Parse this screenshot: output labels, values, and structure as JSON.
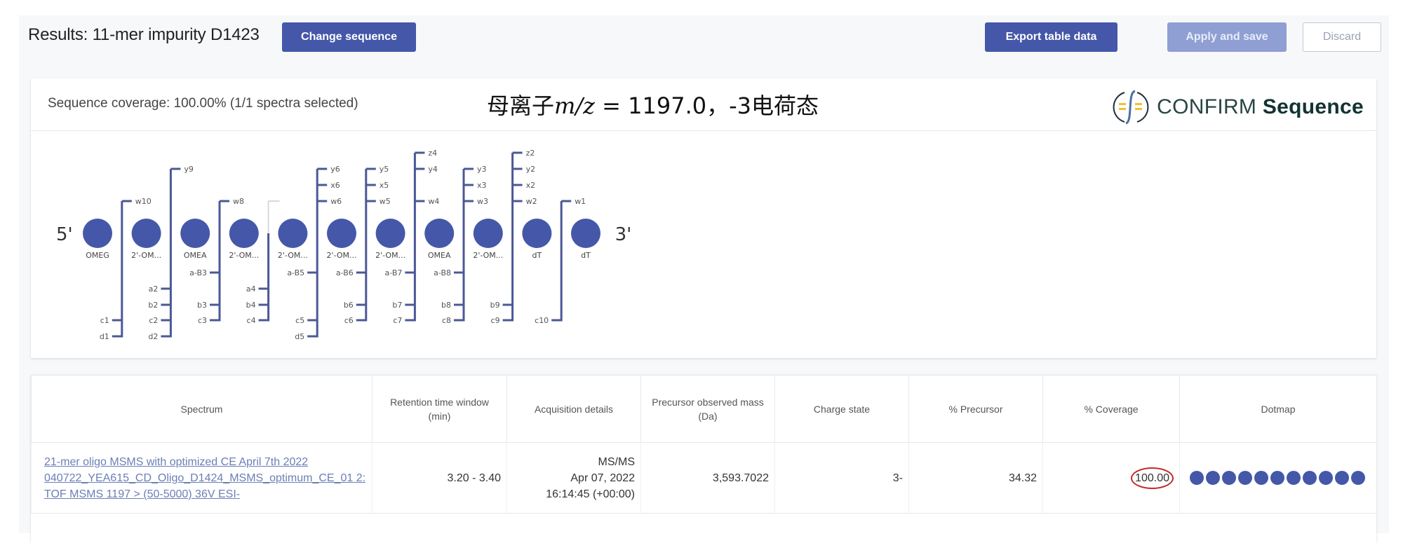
{
  "header": {
    "title": "Results: 11-mer impurity D1423",
    "change_sequence": "Change sequence",
    "export": "Export table data",
    "apply": "Apply and save",
    "discard": "Discard"
  },
  "card": {
    "coverage": "Sequence coverage: 100.00% (1/1 spectra selected)",
    "annotation_prefix": "母离子",
    "annotation_mz": "m/z",
    "annotation_suffix": " = 1197.0，-3电荷态",
    "logo_light": "CONFIRM",
    "logo_bold": "Sequence",
    "logo_icon": "confirm-sequence-logo-icon"
  },
  "sequence": {
    "five_prime": "5'",
    "three_prime": "3'",
    "colors": {
      "nucleotide": "#4557a8",
      "line": "#4b5896",
      "inactive_line": "#d7d9dc"
    },
    "nucleotides": [
      "OMEG",
      "2'-OM...",
      "OMEA",
      "2'-OM...",
      "2'-OM...",
      "2'-OM...",
      "2'-OM...",
      "OMEA",
      "2'-OM...",
      "dT",
      "dT"
    ],
    "cleavage_sites": [
      {
        "upper": [
          "w10"
        ],
        "lower": [
          "c1",
          "d1"
        ]
      },
      {
        "upper": [
          "y9"
        ],
        "lower": [
          "a2",
          "b2",
          "c2",
          "d2"
        ]
      },
      {
        "upper": [
          "w8"
        ],
        "lower": [
          "a-B3",
          "b3",
          "c3"
        ]
      },
      {
        "upper": [],
        "lower": [
          "a4",
          "b4",
          "c4"
        ]
      },
      {
        "upper": [
          "y6",
          "x6",
          "w6"
        ],
        "lower": [
          "a-B5",
          "c5",
          "d5"
        ]
      },
      {
        "upper": [
          "y5",
          "x5",
          "w5"
        ],
        "lower": [
          "a-B6",
          "b6",
          "c6"
        ]
      },
      {
        "upper": [
          "z4",
          "y4",
          "w4"
        ],
        "lower": [
          "a-B7",
          "b7",
          "c7"
        ]
      },
      {
        "upper": [
          "y3",
          "x3",
          "w3"
        ],
        "lower": [
          "a-B8",
          "b8",
          "c8"
        ]
      },
      {
        "upper": [
          "z2",
          "y2",
          "x2",
          "w2"
        ],
        "lower": [
          "b9",
          "c9"
        ]
      },
      {
        "upper": [
          "w1"
        ],
        "lower": [
          "c10"
        ]
      }
    ]
  },
  "table": {
    "columns": [
      "Spectrum",
      "Retention time window (min)",
      "Acquisition details",
      "Precursor observed mass (Da)",
      "Charge state",
      "% Precursor",
      "% Coverage",
      "Dotmap"
    ],
    "rows": [
      {
        "spectrum": "21-mer oligo MSMS with optimized CE April 7th 2022 040722_YEA615_CD_Oligo_D1424_MSMS_optimum_CE_01 2: TOF MSMS 1197 > (50-5000) 36V ESI-",
        "retention": "3.20 - 3.40",
        "acq_type": "MS/MS",
        "acq_date": "Apr 07, 2022",
        "acq_time": "16:14:45 (+00:00)",
        "mass": "3,593.7022",
        "charge": "3-",
        "precursor_pct": "34.32",
        "coverage_pct": "100.00",
        "dotmap_count": 11
      }
    ]
  }
}
